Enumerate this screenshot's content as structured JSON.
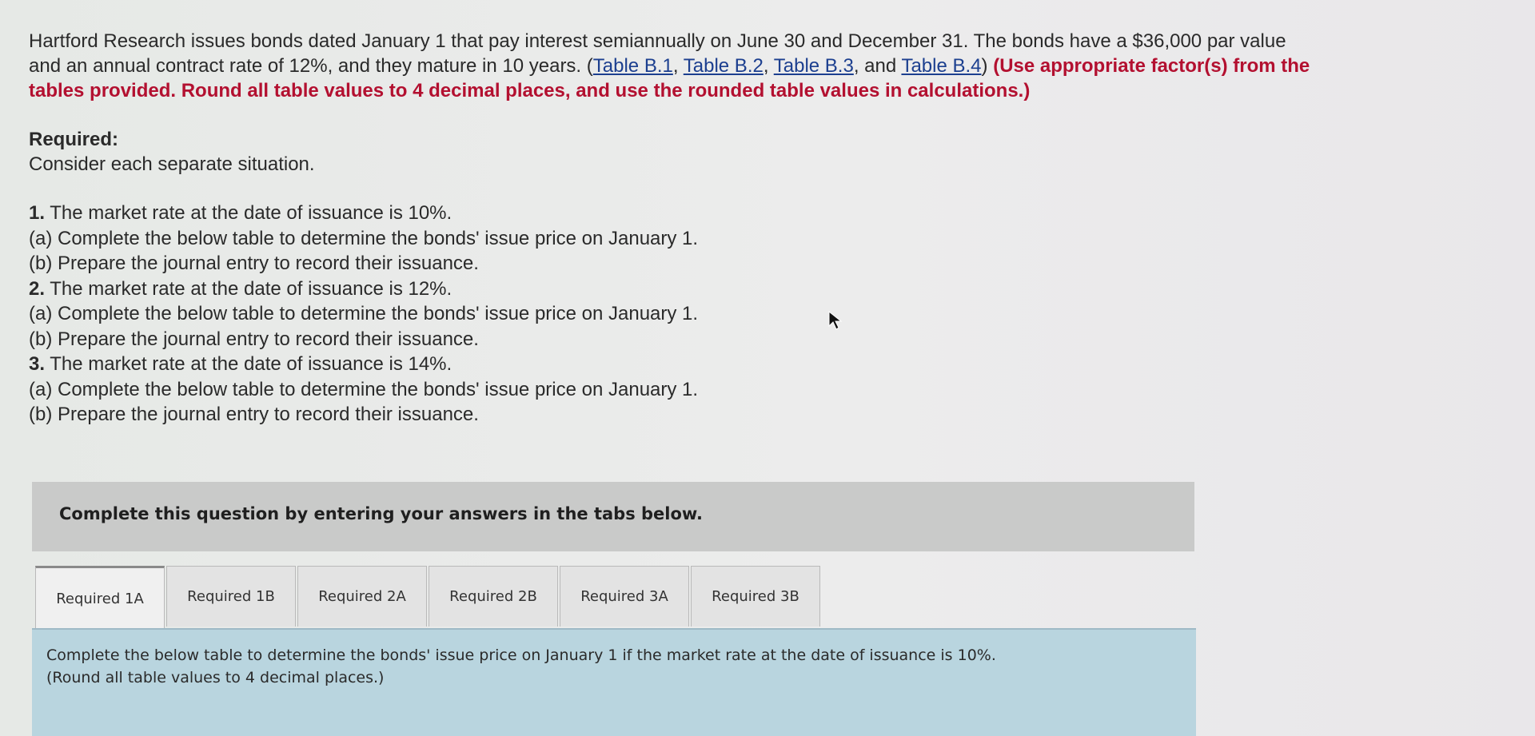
{
  "problem": {
    "intro": "Hartford Research issues bonds dated January 1 that pay interest semiannually on June 30 and December 31. The bonds have a $36,000 par value and an annual contract rate of 12%, and they mature in 10 years. ",
    "links": [
      "Table B.1",
      "Table B.2",
      "Table B.3",
      "Table B.4"
    ],
    "link_sep_1": ", ",
    "link_sep_2": ", ",
    "link_sep_3": ", and ",
    "paren_open": "(",
    "paren_close": ")",
    "instruction": "(Use appropriate factor(s) from the tables provided. Round all table values to 4 decimal places, and use the rounded table values in calculations.)",
    "required_label": "Required:",
    "consider": "Consider each separate situation.",
    "steps": [
      {
        "num": "1.",
        "text": "The market rate at the date of issuance is 10%."
      },
      {
        "num": "",
        "text": "(a) Complete the below table to determine the bonds' issue price on January 1."
      },
      {
        "num": "",
        "text": "(b) Prepare the journal entry to record their issuance."
      },
      {
        "num": "2.",
        "text": "The market rate at the date of issuance is 12%."
      },
      {
        "num": "",
        "text": "(a) Complete the below table to determine the bonds' issue price on January 1."
      },
      {
        "num": "",
        "text": "(b) Prepare the journal entry to record their issuance."
      },
      {
        "num": "3.",
        "text": "The market rate at the date of issuance is 14%."
      },
      {
        "num": "",
        "text": "(a) Complete the below table to determine the bonds' issue price on January 1."
      },
      {
        "num": "",
        "text": "(b) Prepare the journal entry to record their issuance."
      }
    ]
  },
  "tabs_banner": "Complete this question by entering your answers in the tabs below.",
  "tabs": [
    {
      "label": "Required 1A"
    },
    {
      "label": "Required 1B"
    },
    {
      "label": "Required 2A"
    },
    {
      "label": "Required 2B"
    },
    {
      "label": "Required 3A"
    },
    {
      "label": "Required 3B"
    }
  ],
  "panel": {
    "line1": "Complete the below table to determine the bonds' issue price on January 1 if the market rate at the date of issuance is 10%.",
    "line2": "(Round all table values to 4 decimal places.)"
  }
}
